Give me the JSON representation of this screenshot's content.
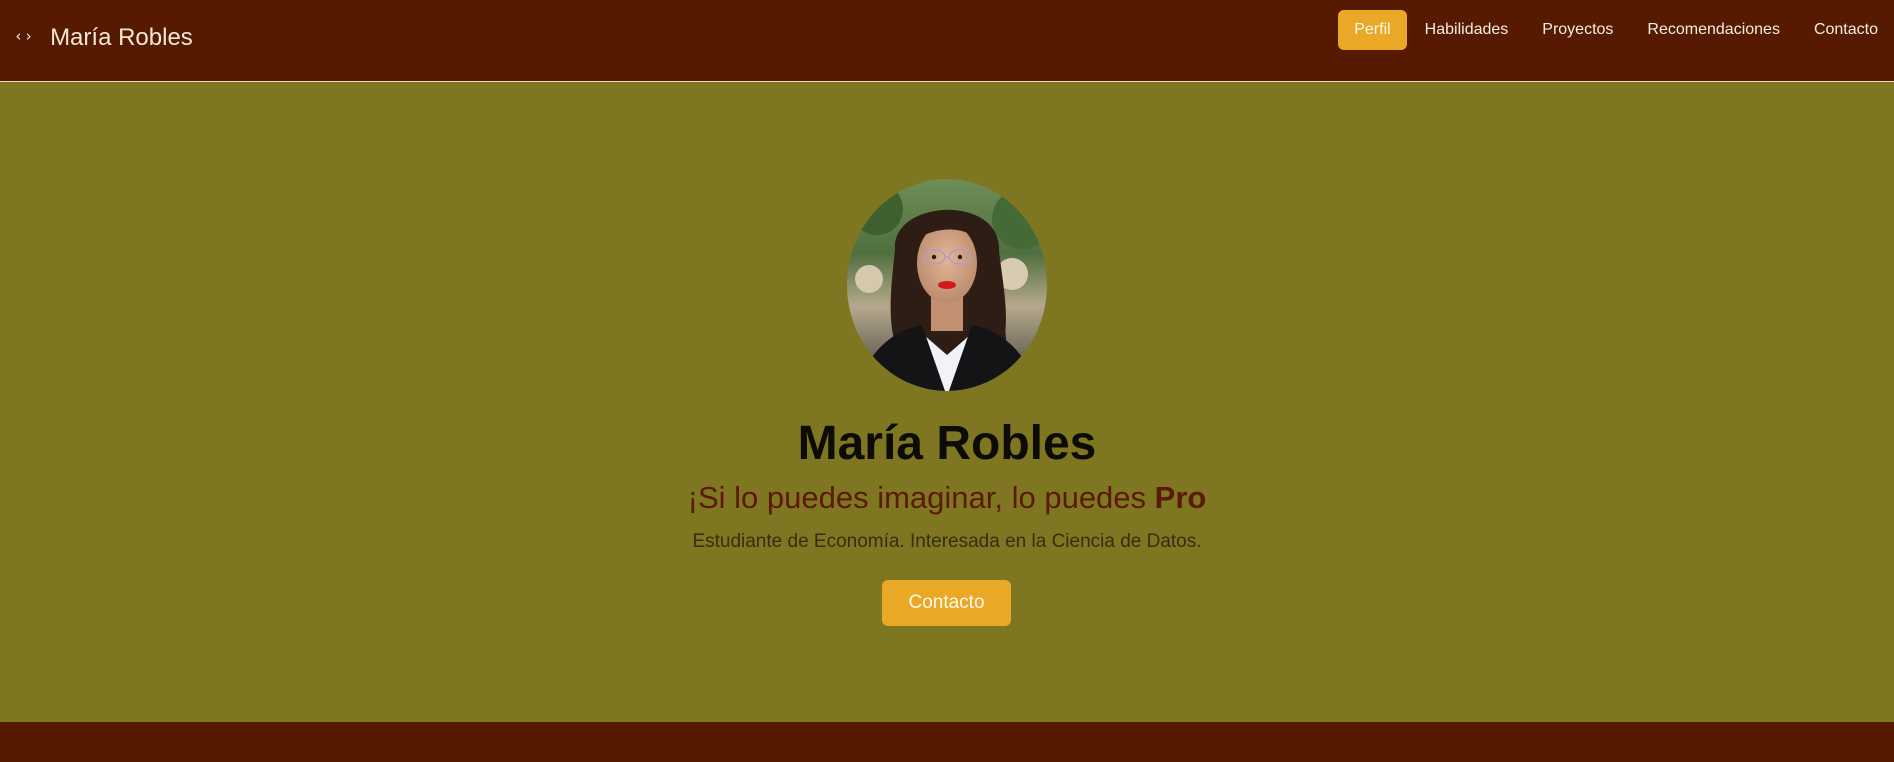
{
  "header": {
    "brand_icon": "‹›",
    "brand_name": "María Robles",
    "nav": [
      {
        "label": "Perfil",
        "active": true
      },
      {
        "label": "Habilidades",
        "active": false
      },
      {
        "label": "Proyectos",
        "active": false
      },
      {
        "label": "Recomendaciones",
        "active": false
      },
      {
        "label": "Contacto",
        "active": false
      }
    ]
  },
  "hero": {
    "name": "María Robles",
    "tagline_prefix": "¡Si lo puedes imaginar, lo puedes ",
    "tagline_bold": "Pro",
    "description": "Estudiante de Economía. Interesada en la Ciencia de Datos.",
    "cta_label": "Contacto"
  },
  "colors": {
    "header_bg": "#561a00",
    "hero_bg": "#7f7622",
    "accent": "#e9a826",
    "tagline": "#5b1a06"
  }
}
